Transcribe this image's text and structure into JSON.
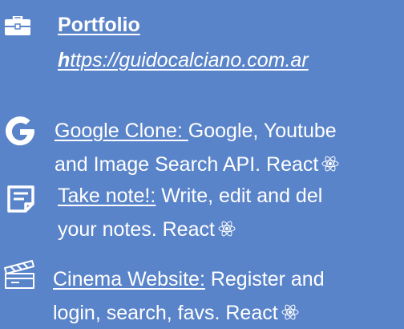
{
  "projects": [
    {
      "icon": "briefcase-icon",
      "title": "Portfolio",
      "url_first_letter": "h",
      "url_rest": "ttps://guidocalciano.com.ar"
    },
    {
      "icon": "google-g-icon",
      "link_label": "Google Clone: ",
      "description_line1": " Google, Youtube",
      "description_line2": "and Image Search API. React"
    },
    {
      "icon": "note-icon",
      "link_label": "Take note!:",
      "description_line1": " Write, edit and del",
      "description_line2": "your notes. React"
    },
    {
      "icon": "clapperboard-icon",
      "link_label": "Cinema Website:",
      "description_line1": " Register and",
      "description_line2": "login, search, favs. React"
    }
  ],
  "react_icon": "react-atom-icon",
  "colors": {
    "background": "#5a84c9",
    "text": "#ffffff",
    "google_icon": "#ffffff"
  }
}
